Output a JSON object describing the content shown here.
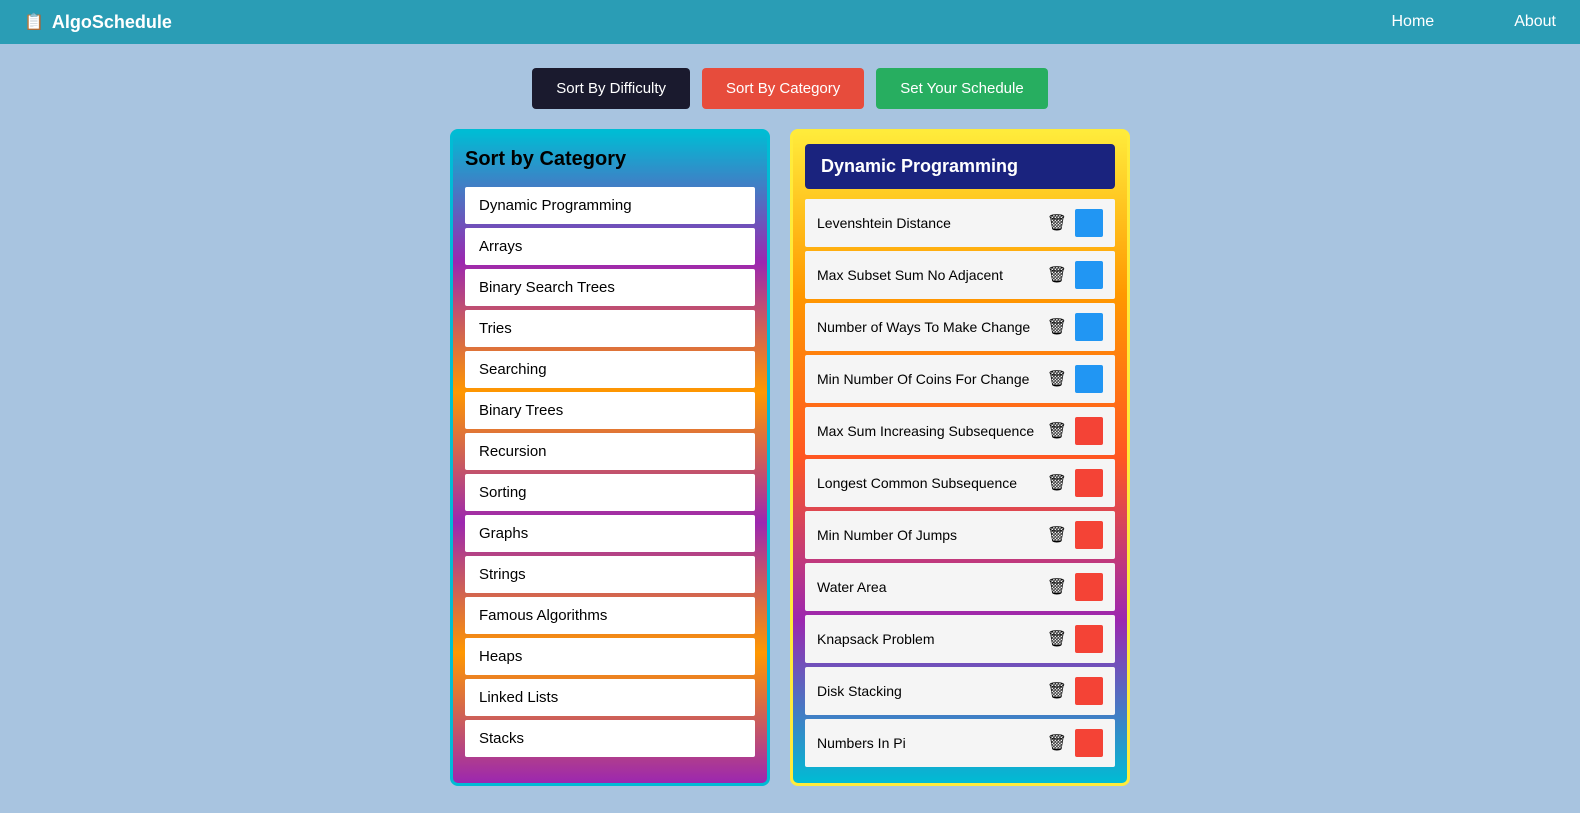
{
  "navbar": {
    "brand_icon": "📋",
    "brand_name": "AlgoSchedule",
    "links": [
      {
        "label": "Home",
        "name": "home-link"
      },
      {
        "label": "About",
        "name": "about-link"
      }
    ]
  },
  "toolbar": {
    "sort_difficulty_label": "Sort By Difficulty",
    "sort_category_label": "Sort By Category",
    "set_schedule_label": "Set Your Schedule"
  },
  "left_panel": {
    "title": "Sort by Category",
    "categories": [
      {
        "label": "Dynamic Programming"
      },
      {
        "label": "Arrays"
      },
      {
        "label": "Binary Search Trees"
      },
      {
        "label": "Tries"
      },
      {
        "label": "Searching"
      },
      {
        "label": "Binary Trees"
      },
      {
        "label": "Recursion"
      },
      {
        "label": "Sorting"
      },
      {
        "label": "Graphs"
      },
      {
        "label": "Strings"
      },
      {
        "label": "Famous Algorithms"
      },
      {
        "label": "Heaps"
      },
      {
        "label": "Linked Lists"
      },
      {
        "label": "Stacks"
      }
    ]
  },
  "right_panel": {
    "title": "Dynamic Programming",
    "algorithms": [
      {
        "name": "Levenshtein Distance",
        "difficulty": "blue"
      },
      {
        "name": "Max Subset Sum No Adjacent",
        "difficulty": "blue"
      },
      {
        "name": "Number of Ways To Make Change",
        "difficulty": "blue"
      },
      {
        "name": "Min Number Of Coins For Change",
        "difficulty": "blue"
      },
      {
        "name": "Max Sum Increasing Subsequence",
        "difficulty": "red"
      },
      {
        "name": "Longest Common Subsequence",
        "difficulty": "red"
      },
      {
        "name": "Min Number Of Jumps",
        "difficulty": "red"
      },
      {
        "name": "Water Area",
        "difficulty": "red"
      },
      {
        "name": "Knapsack Problem",
        "difficulty": "red"
      },
      {
        "name": "Disk Stacking",
        "difficulty": "red"
      },
      {
        "name": "Numbers In Pi",
        "difficulty": "red"
      }
    ],
    "trash_icon": "🗑"
  }
}
